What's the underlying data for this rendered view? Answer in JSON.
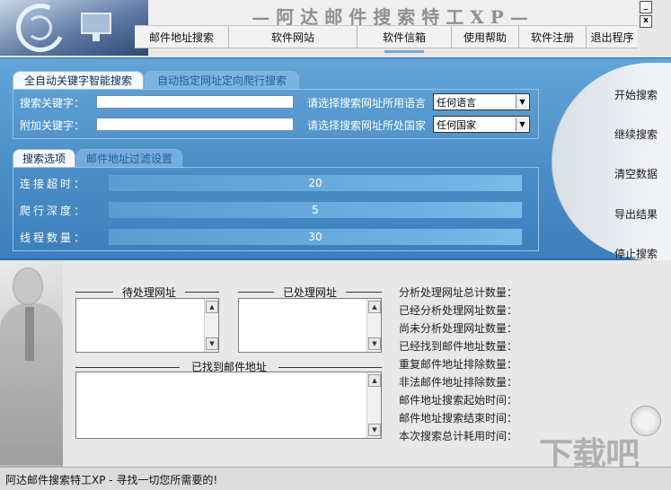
{
  "app": {
    "title": "—阿达邮件搜索特工XP—"
  },
  "window": {
    "minimize": "_",
    "close": "x"
  },
  "menu": [
    "邮件地址搜索",
    "软件网站",
    "软件信箱",
    "使用帮助",
    "软件注册",
    "退出程序"
  ],
  "tabs_top": {
    "active": "全自动关键字智能搜索",
    "inactive": "自动指定网址定向爬行搜索"
  },
  "search": {
    "keyword_label": "搜索关键字：",
    "keyword_value": "",
    "extra_label": "附加关键字：",
    "extra_value": "",
    "language_label": "请选择搜索网址所用语言",
    "language_value": "任何语言",
    "country_label": "请选择搜索网址所处国家",
    "country_value": "任何国家"
  },
  "tabs_bottom": {
    "active": "搜索选项",
    "inactive": "邮件地址过滤设置"
  },
  "options": {
    "timeout_label": "连接超时：",
    "timeout_value": "20",
    "depth_label": "爬行深度：",
    "depth_value": "5",
    "threads_label": "线程数量：",
    "threads_value": "30"
  },
  "side_buttons": [
    "开始搜索",
    "继续搜索",
    "清空数据",
    "导出结果",
    "停止搜索"
  ],
  "lists": {
    "pending_title": "待处理网址",
    "processed_title": "已处理网址",
    "found_title": "已找到邮件地址"
  },
  "stats": [
    "分析处理网址总计数量：",
    "已经分析处理网址数量：",
    "尚未分析处理网址数量：",
    "已经找到邮件地址数量：",
    "重复邮件地址排除数量：",
    "非法邮件地址排除数量：",
    "邮件地址搜索起始时间：",
    "邮件地址搜索结束时间：",
    "本次搜索总计耗用时间："
  ],
  "watermark": "下载吧",
  "status": "阿达邮件搜索特工XP - 寻找一切您所需要的!"
}
